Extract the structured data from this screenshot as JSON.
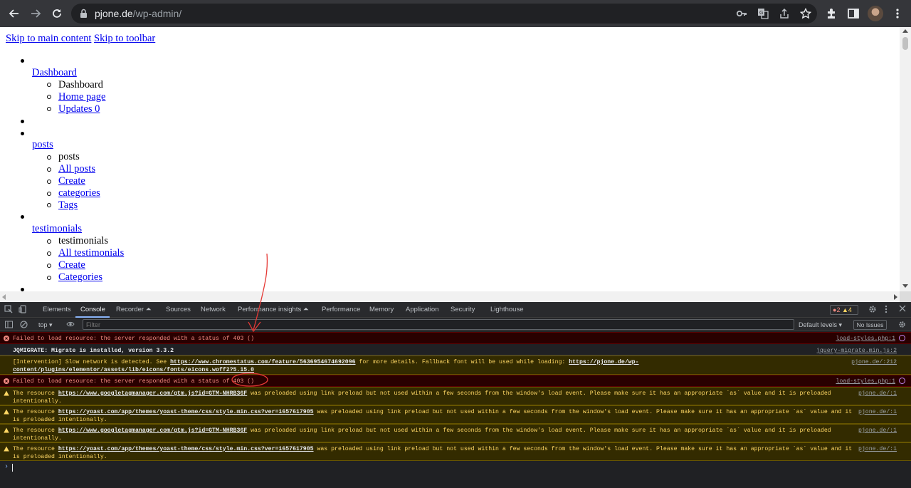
{
  "browser": {
    "url_host": "pjone.de",
    "url_path": "/wp-admin/",
    "icons": [
      "back-icon",
      "forward-icon",
      "reload-icon",
      "lock-icon",
      "key-icon",
      "translate-icon",
      "share-icon",
      "bookmark-star-icon",
      "extensions-icon",
      "side-panel-icon",
      "avatar",
      "menu-icon"
    ]
  },
  "page": {
    "skip_main": "Skip to main content",
    "skip_toolbar": "Skip to toolbar",
    "menu": [
      {
        "label": "Dashboard",
        "children": [
          {
            "label": "Dashboard",
            "link": false
          },
          {
            "label": "Home page",
            "link": true
          },
          {
            "label": "Updates 0",
            "link": true
          }
        ]
      },
      {
        "label": "",
        "children": []
      },
      {
        "label": "posts",
        "children": [
          {
            "label": "posts",
            "link": false
          },
          {
            "label": "All posts",
            "link": true
          },
          {
            "label": "Create",
            "link": true
          },
          {
            "label": "categories",
            "link": true
          },
          {
            "label": "Tags",
            "link": true
          }
        ]
      },
      {
        "label": "testimonials",
        "children": [
          {
            "label": "testimonials",
            "link": false
          },
          {
            "label": "All testimonials",
            "link": true
          },
          {
            "label": "Create",
            "link": true
          },
          {
            "label": "Categories",
            "link": true
          }
        ]
      }
    ]
  },
  "devtools": {
    "tabs": [
      "Elements",
      "Console",
      "Recorder ⏶",
      "Sources",
      "Network",
      "Performance insights ⏶",
      "Performance",
      "Memory",
      "Application",
      "Security",
      "Lighthouse"
    ],
    "active_tab": "Console",
    "error_count": "2",
    "warning_count": "4",
    "context": "top",
    "filter_placeholder": "Filter",
    "levels": "Default levels",
    "issues": "No Issues",
    "messages": [
      {
        "level": "error",
        "text": "Failed to load resource: the server responded with a status of 403 ()",
        "source": "load-styles.php:1"
      },
      {
        "level": "info",
        "text": "JQMIGRATE: Migrate is installed, version 3.3.2",
        "source": "jquery-migrate.min.js:2"
      },
      {
        "level": "warn",
        "text_a": "[Intervention] Slow network is detected. See ",
        "link_a": "https://www.chromestatus.com/feature/5636954674692096",
        "text_b": " for more details. Fallback font will be used while loading: ",
        "link_b": "https://pjone.de/wp-content/plugins/elementor/assets/lib/eicons/fonts/eicons.w",
        "text_c": "off2?5.15.0",
        "source": "pjone.de/:212"
      },
      {
        "level": "error",
        "text": "Failed to load resource: the server responded with a status of 403 ()",
        "source": "load-styles.php:1"
      },
      {
        "level": "warn",
        "text_a": "The resource ",
        "link_a": "https://www.googletagmanager.com/gtm.js?id=GTM-NHRB36F",
        "text_b": " was preloaded using link preload but not used within a few seconds from the window's load event. Please make sure it has an appropriate `as` value and it is preloaded intentionally.",
        "source": "pjone.de/:1"
      },
      {
        "level": "warn",
        "text_a": "The resource ",
        "link_a": "https://yoast.com/app/themes/yoast-theme/css/style.min.css?ver=1657617905",
        "text_b": " was preloaded using link preload but not used within a few seconds from the window's load event. Please make sure it has an appropriate `as` value and it is preloaded intentionally.",
        "source": "pjone.de/:1"
      },
      {
        "level": "warn",
        "text_a": "The resource ",
        "link_a": "https://www.googletagmanager.com/gtm.js?id=GTM-NHRB36F",
        "text_b": " was preloaded using link preload but not used within a few seconds from the window's load event. Please make sure it has an appropriate `as` value and it is preloaded intentionally.",
        "source": "pjone.de/:1"
      },
      {
        "level": "warn",
        "text_a": "The resource ",
        "link_a": "https://yoast.com/app/themes/yoast-theme/css/style.min.css?ver=1657617905",
        "text_b": " was preloaded using link preload but not used within a few seconds from the window's load event. Please make sure it has an appropriate `as` value and it is preloaded intentionally.",
        "source": "pjone.de/:1"
      }
    ]
  },
  "annotation": {
    "color": "#e53935"
  }
}
